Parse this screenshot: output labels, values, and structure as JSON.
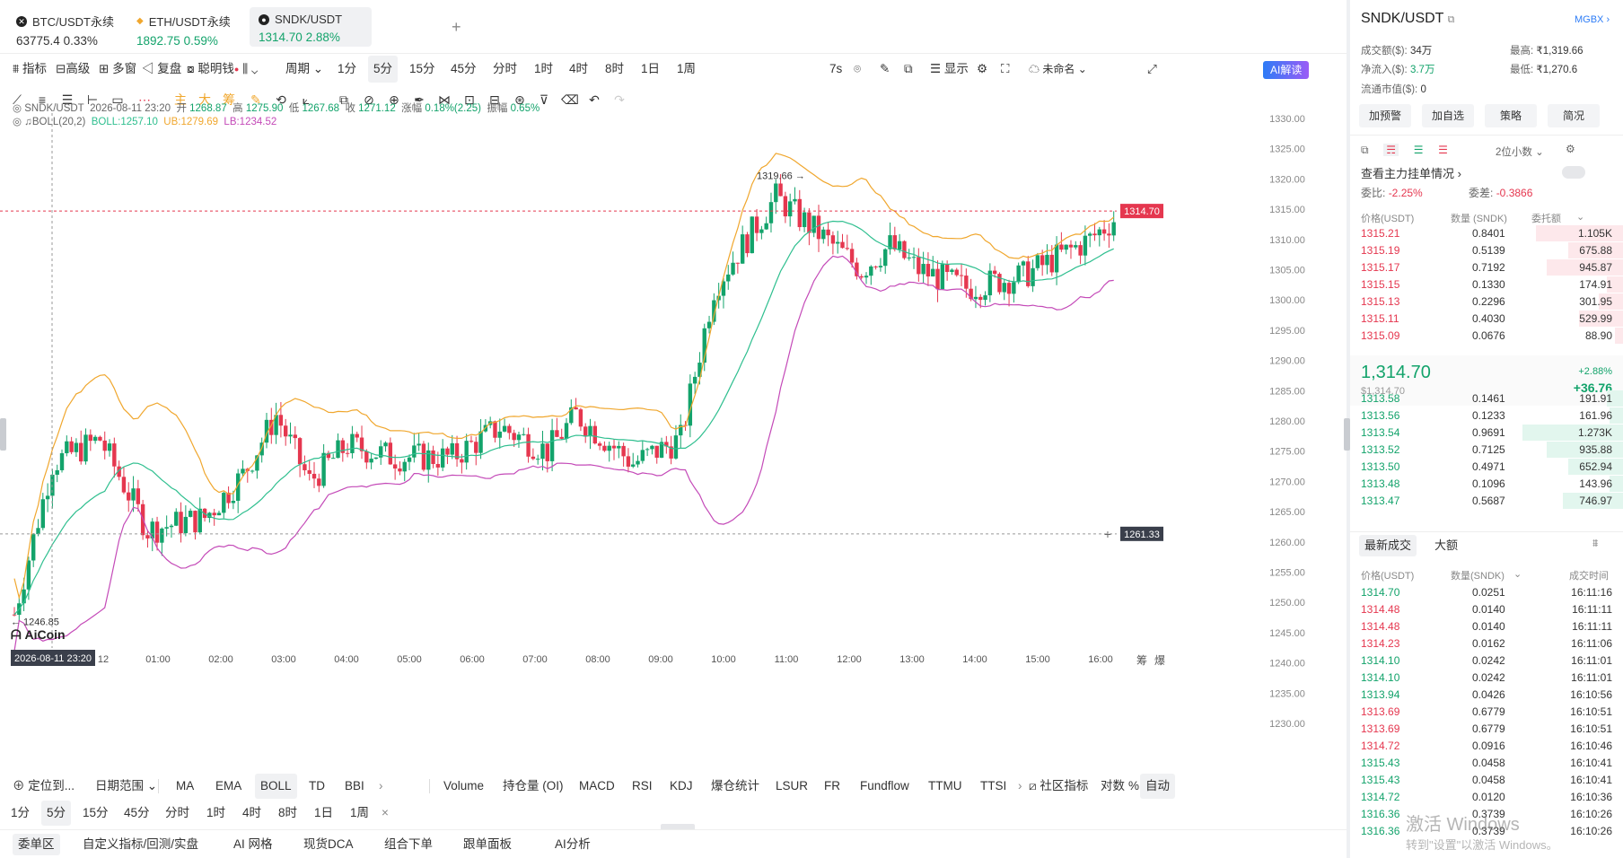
{
  "tabs": [
    {
      "name": "BTC/USDT永续",
      "price": "63775.4",
      "change": "0.33%",
      "color": "#333",
      "icon": "x-logo-icon"
    },
    {
      "name": "ETH/USDT永续",
      "price": "1892.75",
      "change": "0.59%",
      "color": "#13a36b",
      "icon": "eth-diamond-icon"
    },
    {
      "name": "SNDK/USDT",
      "price": "1314.70",
      "change": "2.88%",
      "color": "#13a36b",
      "icon": "sndk-logo-icon",
      "active": true
    }
  ],
  "toolbar": {
    "indicators": "指标",
    "advanced": "高级",
    "multi_window": "多窗",
    "replay": "复盘",
    "smart_money": "聪明钱",
    "period": "周期",
    "intervals": [
      "1分",
      "5分",
      "15分",
      "45分",
      "分时",
      "1时",
      "4时",
      "8时",
      "1日",
      "1周"
    ],
    "selected_interval": "5分",
    "countdown": "7s",
    "display": "显示",
    "unnamed": "未命名",
    "ai_read": "AI解读"
  },
  "legend": {
    "symbol": "SNDK/USDT",
    "datetime": "2026-08-11 23:20",
    "open_label": "开",
    "open": "1268.87",
    "high_label": "高",
    "high": "1275.90",
    "low_label": "低",
    "low": "1267.68",
    "close_label": "收",
    "close": "1271.12",
    "chg_label": "涨幅",
    "chg": "0.18%(2.25)",
    "amp_label": "振幅",
    "amp": "0.65%",
    "boll": "BOLL(20,2)",
    "boll_mid": "BOLL:1257.10",
    "boll_ub": "UB:1279.69",
    "boll_lb": "LB:1234.52"
  },
  "chart": {
    "price_ticks": [
      "1330.00",
      "1325.00",
      "1320.00",
      "1315.00",
      "1310.00",
      "1305.00",
      "1300.00",
      "1295.00",
      "1290.00",
      "1285.00",
      "1280.00",
      "1275.00",
      "1270.00",
      "1265.00",
      "1260.00",
      "1255.00",
      "1250.00",
      "1245.00",
      "1240.00",
      "1235.00",
      "1230.00"
    ],
    "time_ticks": [
      "12",
      "01:00",
      "02:00",
      "03:00",
      "04:00",
      "05:00",
      "06:00",
      "07:00",
      "08:00",
      "09:00",
      "10:00",
      "11:00",
      "12:00",
      "13:00",
      "14:00",
      "15:00",
      "16:00"
    ],
    "last_price": "1314.70",
    "crosshair_price": "1261.33",
    "high_marker": "1319.66",
    "low_marker": "1246.85",
    "crosshair_time": "2026-08-11 23:20",
    "logo": "AiCoin",
    "corner_a": "筹",
    "corner_b": "爆",
    "colors": {
      "up": "#13a36b",
      "down": "#e5374f",
      "mid": "#2fbf8f",
      "ub": "#f0a72e",
      "lb": "#c44ab8"
    }
  },
  "bottom": {
    "locate": "定位到...",
    "date_range": "日期范围",
    "indicators": [
      "MA",
      "EMA",
      "BOLL",
      "TD",
      "BBI"
    ],
    "selected_indicator": "BOLL",
    "sub_indicators": [
      "Volume",
      "持仓量 (OI)",
      "MACD",
      "RSI",
      "KDJ",
      "爆仓统计",
      "LSUR",
      "FR",
      "Fundflow",
      "TTMU",
      "TTSI"
    ],
    "community": "社区指标",
    "log": "对数",
    "pct": "%",
    "auto": "自动",
    "intervals": [
      "1分",
      "5分",
      "15分",
      "45分",
      "分时",
      "1时",
      "4时",
      "8时",
      "1日",
      "1周"
    ],
    "selected_interval": "5分",
    "close": "×"
  },
  "footer": {
    "items": [
      "委单区",
      "自定义指标/回测/实盘",
      "AI 网格",
      "现货DCA",
      "组合下单",
      "跟单面板",
      "AI分析"
    ]
  },
  "panel": {
    "symbol": "SNDK/USDT",
    "badge": "MGBX",
    "stats": [
      {
        "k": "成交额($):",
        "v": "34万"
      },
      {
        "k": "净流入($):",
        "v": "3.7万"
      },
      {
        "k": "流通市值($):",
        "v": "0"
      }
    ],
    "hl": [
      {
        "k": "最高:",
        "v": "₹1,319.66"
      },
      {
        "k": "最低:",
        "v": "₹1,270.6"
      }
    ],
    "buttons": [
      "加预警",
      "加自选",
      "策略",
      "简况"
    ],
    "decimals": "2位小数",
    "main_orders": "查看主力挂单情况",
    "ratio_label": "委比:",
    "ratio": "-2.25%",
    "diff_label": "委差:",
    "diff": "-0.3866",
    "ob_headers": [
      "价格(USDT)",
      "数量 (SNDK)",
      "委托额"
    ],
    "asks": [
      {
        "p": "1315.21",
        "q": "0.8401",
        "a": "1.105K",
        "w": 0.32
      },
      {
        "p": "1315.19",
        "q": "0.5139",
        "a": "675.88",
        "w": 0.2
      },
      {
        "p": "1315.17",
        "q": "0.7192",
        "a": "945.87",
        "w": 0.28
      },
      {
        "p": "1315.15",
        "q": "0.1330",
        "a": "174.91",
        "w": 0.06
      },
      {
        "p": "1315.13",
        "q": "0.2296",
        "a": "301.95",
        "w": 0.09
      },
      {
        "p": "1315.11",
        "q": "0.4030",
        "a": "529.99",
        "w": 0.16
      },
      {
        "p": "1315.09",
        "q": "0.0676",
        "a": "88.90",
        "w": 0.03
      }
    ],
    "last": "1,314.70",
    "last_usd": "$1,314.70",
    "last_pct": "+2.88%",
    "last_chg": "+36.76",
    "bids": [
      {
        "p": "1313.58",
        "q": "0.1461",
        "a": "191.91",
        "w": 0.06
      },
      {
        "p": "1313.56",
        "q": "0.1233",
        "a": "161.96",
        "w": 0.05
      },
      {
        "p": "1313.54",
        "q": "0.9691",
        "a": "1.273K",
        "w": 0.37
      },
      {
        "p": "1313.52",
        "q": "0.7125",
        "a": "935.88",
        "w": 0.28
      },
      {
        "p": "1313.50",
        "q": "0.4971",
        "a": "652.94",
        "w": 0.2
      },
      {
        "p": "1313.48",
        "q": "0.1096",
        "a": "143.96",
        "w": 0.05
      },
      {
        "p": "1313.47",
        "q": "0.5687",
        "a": "746.97",
        "w": 0.22
      }
    ],
    "trade_tabs": [
      "最新成交",
      "大额"
    ],
    "trade_headers": [
      "价格(USDT)",
      "数量(SNDK)",
      "成交时间"
    ],
    "trades": [
      {
        "p": "1314.70",
        "q": "0.0251",
        "t": "16:11:16",
        "s": "buy"
      },
      {
        "p": "1314.48",
        "q": "0.0140",
        "t": "16:11:11",
        "s": "sell"
      },
      {
        "p": "1314.48",
        "q": "0.0140",
        "t": "16:11:11",
        "s": "sell"
      },
      {
        "p": "1314.23",
        "q": "0.0162",
        "t": "16:11:06",
        "s": "sell"
      },
      {
        "p": "1314.10",
        "q": "0.0242",
        "t": "16:11:01",
        "s": "buy"
      },
      {
        "p": "1314.10",
        "q": "0.0242",
        "t": "16:11:01",
        "s": "buy"
      },
      {
        "p": "1313.94",
        "q": "0.0426",
        "t": "16:10:56",
        "s": "buy"
      },
      {
        "p": "1313.69",
        "q": "0.6779",
        "t": "16:10:51",
        "s": "sell"
      },
      {
        "p": "1313.69",
        "q": "0.6779",
        "t": "16:10:51",
        "s": "sell"
      },
      {
        "p": "1314.72",
        "q": "0.0916",
        "t": "16:10:46",
        "s": "sell"
      },
      {
        "p": "1315.43",
        "q": "0.0458",
        "t": "16:10:41",
        "s": "buy"
      },
      {
        "p": "1315.43",
        "q": "0.0458",
        "t": "16:10:41",
        "s": "buy"
      },
      {
        "p": "1314.72",
        "q": "0.0120",
        "t": "16:10:36",
        "s": "buy"
      },
      {
        "p": "1316.36",
        "q": "0.3739",
        "t": "16:10:26",
        "s": "buy"
      },
      {
        "p": "1316.36",
        "q": "0.3739",
        "t": "16:10:26",
        "s": "buy"
      }
    ]
  },
  "watermark": {
    "line1": "激活 Windows",
    "line2": "转到\"设置\"以激活 Windows。"
  }
}
